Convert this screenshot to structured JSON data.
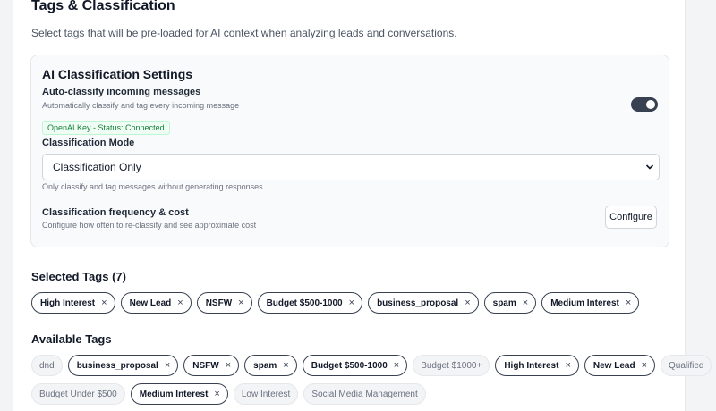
{
  "page": {
    "title": "Tags & Classification",
    "description": "Select tags that will be pre-loaded for AI context when analyzing leads and conversations."
  },
  "ai_settings": {
    "title": "AI Classification Settings",
    "auto_classify": {
      "label": "Auto-classify incoming messages",
      "help": "Automatically classify and tag every incoming message",
      "status": "OpenAI Key - Status: Connected",
      "enabled": true
    },
    "mode": {
      "label": "Classification Mode",
      "selected": "Classification Only",
      "help": "Only classify and tag messages without generating responses"
    },
    "frequency": {
      "label": "Classification frequency & cost",
      "help": "Configure how often to re-classify and see approximate cost",
      "button": "Configure"
    }
  },
  "selected_tags": {
    "title": "Selected Tags (7)",
    "items": [
      "High Interest",
      "New Lead",
      "NSFW",
      "Budget $500-1000",
      "business_proposal",
      "spam",
      "Medium Interest"
    ],
    "remove_glyph": "×"
  },
  "available_tags": {
    "title": "Available Tags",
    "rows": [
      [
        {
          "label": "dnd",
          "selected": false
        },
        {
          "label": "business_proposal",
          "selected": true
        },
        {
          "label": "NSFW",
          "selected": true
        },
        {
          "label": "spam",
          "selected": true
        },
        {
          "label": "Budget $500-1000",
          "selected": true
        },
        {
          "label": "Budget $1000+",
          "selected": false
        },
        {
          "label": "High Interest",
          "selected": true
        },
        {
          "label": "New Lead",
          "selected": true
        },
        {
          "label": "Qualified",
          "selected": false
        }
      ],
      [
        {
          "label": "Budget Under $500",
          "selected": false
        },
        {
          "label": "Medium Interest",
          "selected": true
        },
        {
          "label": "Low Interest",
          "selected": false
        },
        {
          "label": "Social Media Management",
          "selected": false
        }
      ]
    ]
  },
  "colors": {
    "toggle_on": "#374151",
    "status_green": "#15803d",
    "tag_border": "#374151"
  }
}
